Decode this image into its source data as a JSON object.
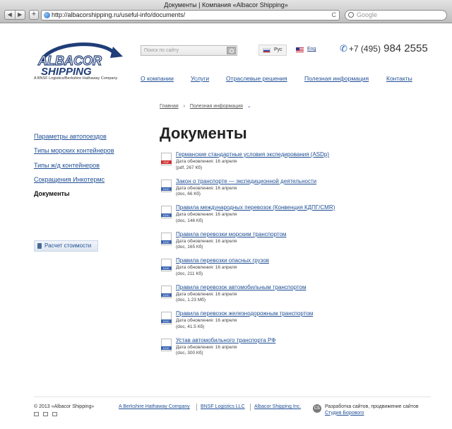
{
  "browser": {
    "title": "Документы | Компания «Albacor Shipping»",
    "url": "http://albacorshipping.ru/useful-info/documents/",
    "search_placeholder": "Google",
    "back": "◀",
    "forward": "▶",
    "add": "+"
  },
  "header": {
    "logo_text_1": "ALBACOR",
    "logo_text_2": "SHIPPING",
    "tagline": "A BNSF Logistics/Berkshire Hathaway Company",
    "search_placeholder": "Поиск по сайту",
    "lang_ru": "Рус",
    "lang_en": "Eng",
    "phone_prefix": "+7 (495)",
    "phone_number": "984 2555"
  },
  "nav": [
    {
      "label": "О компании"
    },
    {
      "label": "Услуги"
    },
    {
      "label": "Отраслевые решения"
    },
    {
      "label": "Полезная информация"
    },
    {
      "label": "Контакты"
    }
  ],
  "breadcrumb": {
    "home": "Главная",
    "sep": "›",
    "current": "Полезная информация",
    "chevron": "⌄"
  },
  "sidebar": {
    "items": [
      {
        "label": "Параметры автопоездов"
      },
      {
        "label": "Типы морских контейнеров"
      },
      {
        "label": "Типы ж/д контейнеров"
      },
      {
        "label": "Сокращения Инкотермс"
      },
      {
        "label": "Документы"
      }
    ],
    "calc_button": "Расчет стоимости"
  },
  "main": {
    "title": "Документы",
    "documents": [
      {
        "name": "Германские стандартные условия экспедирования (ASDp)",
        "updated": "Дата обновления: 16 апреля",
        "info": "(pdf, 267 Кб)",
        "type": "PDF"
      },
      {
        "name": "Закон о транспорте — экспедиционной деятельности",
        "updated": "Дата обновления: 16 апреля",
        "info": "(doc, 66 Кб)",
        "type": "DOC"
      },
      {
        "name": "Правила международных перевозок (Конвенция КДПГ/CMR)",
        "updated": "Дата обновления: 16 апреля",
        "info": "(doc, 146 Кб)",
        "type": "DOC"
      },
      {
        "name": "Правила перевозки морским транспортом",
        "updated": "Дата обновления: 16 апреля",
        "info": "(doc, 165 Кб)",
        "type": "DOC"
      },
      {
        "name": "Правила перевозки опасных грузов",
        "updated": "Дата обновления: 16 апреля",
        "info": "(doc, 211 Кб)",
        "type": "DOC"
      },
      {
        "name": "Правила перевозок автомобильным транспортом",
        "updated": "Дата обновления: 16 апреля",
        "info": "(doc, 1.23 Мб)",
        "type": "DOC"
      },
      {
        "name": "Правила перевозок железнодорожным транспортом",
        "updated": "Дата обновления: 16 апреля",
        "info": "(doc, 41.5 Кб)",
        "type": "DOC"
      },
      {
        "name": "Устав автомобильного транспорта РФ",
        "updated": "Дата обновления: 16 апреля",
        "info": "(doc, 300 Кб)",
        "type": "DOC"
      }
    ]
  },
  "footer": {
    "copyright": "© 2013 «Albacor Shipping»",
    "link1": "A Berkshire Hathaway Company",
    "link2": "BNSF Logistics LLC",
    "link3": "Albacor Shipping Inc.",
    "studio_line": "Разработка сайтов, продвижение сайтов",
    "studio_link": "Студия Борового",
    "studio_badge": "СБ"
  },
  "colors": {
    "link": "#1f4f95",
    "accent": "#2a64b4",
    "pdf": "#d02e2e",
    "doc": "#3b64b0"
  }
}
